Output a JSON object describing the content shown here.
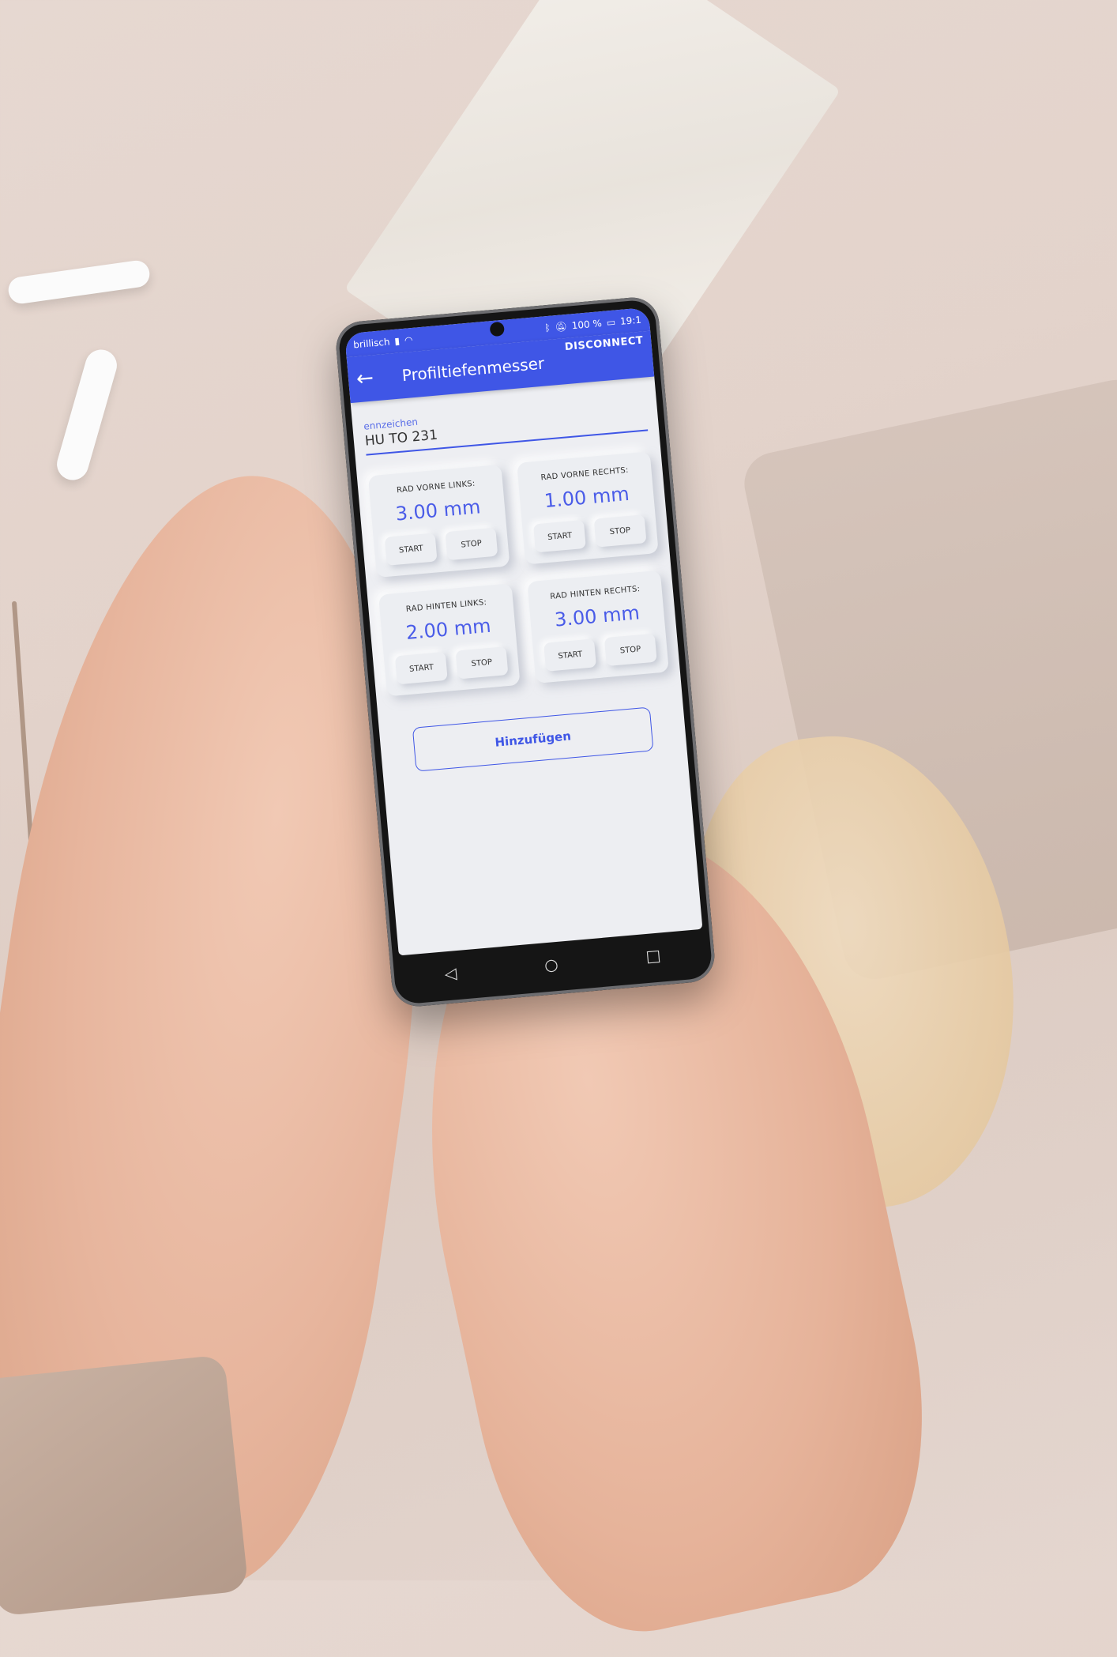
{
  "status_bar": {
    "carrier": "brillisch",
    "battery": "100 %",
    "time": "19:1"
  },
  "app_bar": {
    "title": "Profiltiefenmesser",
    "disconnect_label": "DISCONNECT"
  },
  "plate": {
    "label": "ennzeichen",
    "value": "HU TO 231"
  },
  "wheels": [
    {
      "label": "RAD VORNE LINKS:",
      "value": "3.00 mm",
      "start": "START",
      "stop": "STOP"
    },
    {
      "label": "RAD VORNE RECHTS:",
      "value": "1.00 mm",
      "start": "START",
      "stop": "STOP"
    },
    {
      "label": "RAD HINTEN LINKS:",
      "value": "2.00 mm",
      "start": "START",
      "stop": "STOP"
    },
    {
      "label": "RAD HINTEN RECHTS:",
      "value": "3.00 mm",
      "start": "START",
      "stop": "STOP"
    }
  ],
  "add_button": {
    "label": "Hinzufügen"
  },
  "icons": {
    "back": "arrow-left-icon",
    "nav_back": "triangle-back-icon",
    "nav_home": "circle-home-icon",
    "nav_recent": "square-recent-icon"
  },
  "colors": {
    "accent": "#3f56e6",
    "value_text": "#4a5ce8"
  }
}
